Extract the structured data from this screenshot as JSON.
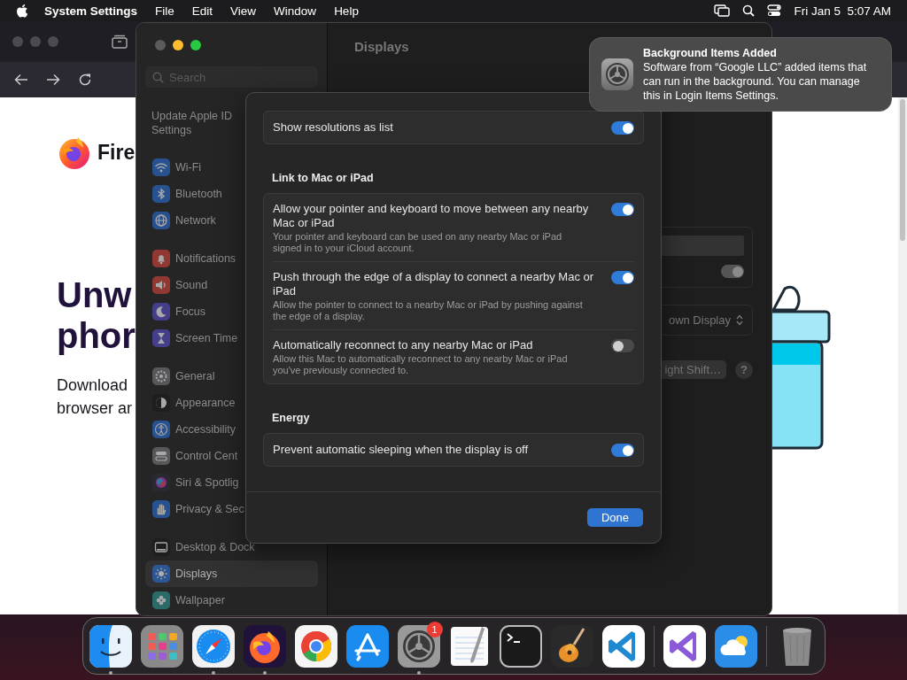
{
  "menu_bar": {
    "app_name": "System Settings",
    "menus": [
      "File",
      "Edit",
      "View",
      "Window",
      "Help"
    ],
    "clock": "Fri Jan 5  5:07 AM"
  },
  "browser": {
    "brand": "Fire",
    "heading_lines": [
      "Unw",
      "phor"
    ],
    "body_lines": [
      "Download",
      "browser ar"
    ]
  },
  "settings": {
    "search_placeholder": "Search",
    "title": "Displays",
    "sidebar": [
      [
        {
          "kind": "account",
          "label": "Update Apple ID Settings",
          "selected": false
        }
      ],
      [
        {
          "kind": "wifi",
          "label": "Wi-Fi",
          "selected": false
        },
        {
          "kind": "bluetooth",
          "label": "Bluetooth",
          "selected": false
        },
        {
          "kind": "network",
          "label": "Network",
          "selected": false
        }
      ],
      [
        {
          "kind": "notifications",
          "label": "Notifications",
          "selected": false
        },
        {
          "kind": "sound",
          "label": "Sound",
          "selected": false
        },
        {
          "kind": "focus",
          "label": "Focus",
          "selected": false
        },
        {
          "kind": "screentime",
          "label": "Screen Time",
          "selected": false
        }
      ],
      [
        {
          "kind": "general",
          "label": "General",
          "selected": false
        },
        {
          "kind": "appearance",
          "label": "Appearance",
          "selected": false
        },
        {
          "kind": "accessibility",
          "label": "Accessibility",
          "selected": false
        },
        {
          "kind": "controlcenter",
          "label": "Control Cent",
          "selected": false
        },
        {
          "kind": "siri",
          "label": "Siri & Spotlig",
          "selected": false
        },
        {
          "kind": "privacy",
          "label": "Privacy & Sec",
          "selected": false
        }
      ],
      [
        {
          "kind": "desktop",
          "label": "Desktop & Dock",
          "selected": false
        },
        {
          "kind": "displays",
          "label": "Displays",
          "selected": true
        },
        {
          "kind": "wallpaper",
          "label": "Wallpaper",
          "selected": false
        }
      ]
    ],
    "background_controls": {
      "toggle_on": true,
      "popup": "own Display",
      "button": "ight Shift…",
      "help": "?"
    }
  },
  "sheet": {
    "sections": [
      {
        "rows": [
          {
            "title": "Show resolutions as list",
            "on": true
          }
        ]
      },
      {
        "heading": "Link to Mac or iPad",
        "rows": [
          {
            "title": "Allow your pointer and keyboard to move between any nearby Mac or iPad",
            "description": "Your pointer and keyboard can be used on any nearby Mac or iPad signed in to your iCloud account.",
            "on": true
          },
          {
            "title": "Push through the edge of a display to connect a nearby Mac or iPad",
            "description": "Allow the pointer to connect to a nearby Mac or iPad by pushing against the edge of a display.",
            "on": true
          },
          {
            "title": "Automatically reconnect to any nearby Mac or iPad",
            "description": "Allow this Mac to automatically reconnect to any nearby Mac or iPad you've previously connected to.",
            "on": false
          }
        ]
      },
      {
        "heading": "Energy",
        "rows": [
          {
            "title": "Prevent automatic sleeping when the display is off",
            "on": true
          }
        ]
      }
    ],
    "done_button": "Done"
  },
  "notification": {
    "title": "Background Items Added",
    "body": "Software from “Google LLC” added items that can run in the background. You can manage this in Login Items Settings."
  },
  "dock": [
    {
      "kind": "finder",
      "running": true
    },
    {
      "kind": "launchpad",
      "running": false
    },
    {
      "kind": "safari",
      "running": true
    },
    {
      "kind": "firefox",
      "running": true
    },
    {
      "kind": "chrome",
      "running": false
    },
    {
      "kind": "appstore",
      "running": false
    },
    {
      "kind": "settings",
      "running": true,
      "badge": "1"
    },
    {
      "kind": "textedit",
      "running": false
    },
    {
      "kind": "terminal",
      "running": false
    },
    {
      "kind": "garageband",
      "running": false
    },
    {
      "kind": "vscode",
      "running": false
    },
    {
      "kind": "separator"
    },
    {
      "kind": "visualstudio",
      "running": false
    },
    {
      "kind": "weather",
      "running": false
    },
    {
      "kind": "separator"
    },
    {
      "kind": "trash",
      "running": false
    }
  ]
}
